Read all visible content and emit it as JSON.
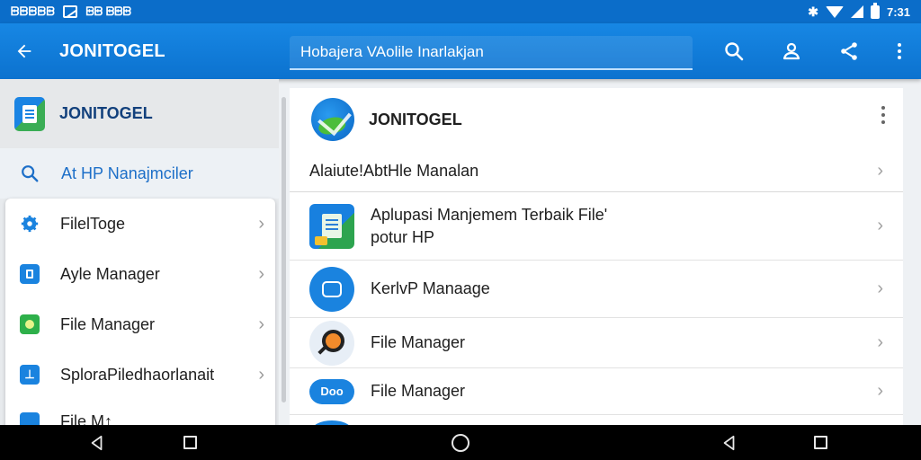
{
  "status_bar": {
    "left_text": "ᗸᗸᗸᗸᗸ",
    "carrier": "ᗸᗸᗸᗸᗸᗸᗸᗸᗸᗸ",
    "extra": "ᗸᗸ ᗸᗸᗸ",
    "time": "7:31"
  },
  "app_bar": {
    "title": "JONITOGEL",
    "search_value": "Hobajera VAolile Inarlakjan"
  },
  "sidebar": {
    "header_title": "JONITOGEL",
    "search_label": "At HP Nanajmciler",
    "items": [
      {
        "label": "FilelToge",
        "color": "#1a83df"
      },
      {
        "label": "Ayle Manager",
        "color": "#1a83df"
      },
      {
        "label": "File Manager",
        "color": "#2eb04a"
      },
      {
        "label": "SplorаPiledhaorlanait",
        "color": "#1a83df"
      },
      {
        "label": "File M↑",
        "color": "#1a83df"
      }
    ]
  },
  "main": {
    "header_title": "JONITOGEL",
    "subtitle": "Alaiute!AbtHle Manalan",
    "rows": [
      {
        "line1": "Aplupasi Manjemem Terbaik File'",
        "line2": "potur HP",
        "icon": "file-app-icon"
      },
      {
        "line1": "KerlvP  Manaage",
        "line2": "",
        "icon": "folder-round-icon"
      },
      {
        "line1": "File Manager",
        "line2": "",
        "icon": "search-magnifier-icon"
      },
      {
        "line1": "File Manager",
        "line2": "",
        "icon": "pill-icon",
        "badge": "Doo"
      }
    ]
  },
  "colors": {
    "accent": "#0c72cf",
    "status_bar": "#0b6dc9",
    "nav_bar": "#000000"
  }
}
